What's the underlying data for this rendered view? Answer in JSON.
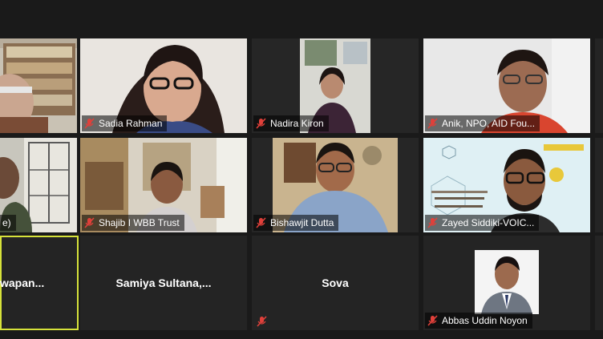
{
  "participants": [
    {
      "name": "",
      "muted": true
    },
    {
      "name": "Sadia Rahman",
      "muted": true
    },
    {
      "name": "Nadira Kiron",
      "muted": true
    },
    {
      "name": "Anik, NPO, AID Fou...",
      "muted": true
    },
    {
      "name": "",
      "muted": true
    },
    {
      "name": "e)",
      "muted": false
    },
    {
      "name": "Shajib I WBB Trust",
      "muted": true
    },
    {
      "name": "Bishawjit Dutta",
      "muted": true
    },
    {
      "name": "Zayed Siddiki-VOIC...",
      "muted": true
    },
    {
      "name": "",
      "muted": true
    },
    {
      "name": "wapan...",
      "muted": false
    },
    {
      "name": "Samiya  Sultana,...",
      "muted": false
    },
    {
      "name": "Sova",
      "muted": true
    },
    {
      "name": "Abbas Uddin Noyon",
      "muted": true
    },
    {
      "name": "",
      "muted": true
    }
  ],
  "colors": {
    "muted_icon": "#e0403a",
    "active_speaker_border": "#d6e23a",
    "background": "#1a1a1a",
    "tile": "#242424"
  }
}
